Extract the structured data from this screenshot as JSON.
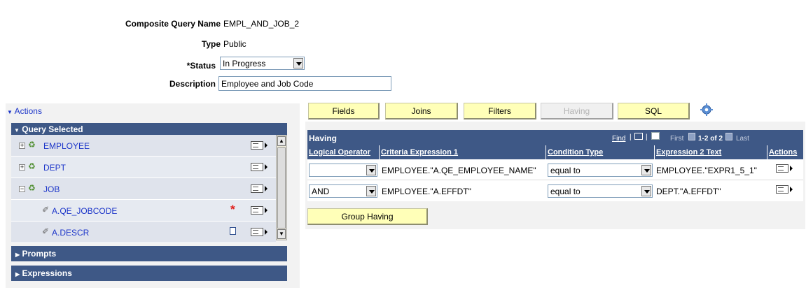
{
  "header": {
    "name_label": "Composite Query Name",
    "name_value": "EMPL_AND_JOB_2",
    "type_label": "Type",
    "type_value": "Public",
    "status_label": "*Status",
    "status_value": "In Progress",
    "description_label": "Description",
    "description_value": "Employee and Job Code"
  },
  "left": {
    "actions_label": "Actions",
    "query_selected_label": "Query Selected",
    "tree": [
      {
        "label": "EMPLOYEE",
        "expander": "+"
      },
      {
        "label": "DEPT",
        "expander": "+"
      },
      {
        "label": "JOB",
        "expander": "−"
      },
      {
        "label": "A.QE_JOBCODE",
        "required_marker": "*"
      },
      {
        "label": "A.DESCR"
      }
    ],
    "prompts_label": "Prompts",
    "expressions_label": "Expressions"
  },
  "tabs": {
    "fields": "Fields",
    "joins": "Joins",
    "filters": "Filters",
    "having": "Having",
    "sql": "SQL"
  },
  "grid": {
    "title": "Having",
    "find_label": "Find",
    "first_label": "First",
    "range_label": "1-2 of 2",
    "last_label": "Last",
    "columns": [
      "Logical Operator",
      "Criteria Expression 1",
      "Condition Type",
      "Expression 2 Text",
      "Actions"
    ],
    "rows": [
      {
        "logical": "",
        "criteria": "EMPLOYEE.\"A.QE_EMPLOYEE_NAME\"",
        "condition": "equal to",
        "expr2": "EMPLOYEE.\"EXPR1_5_1\""
      },
      {
        "logical": "AND",
        "criteria": "EMPLOYEE.\"A.EFFDT\"",
        "condition": "equal to",
        "expr2": "DEPT.\"A.EFFDT\""
      }
    ],
    "group_having_label": "Group Having"
  },
  "colors": {
    "header_blue": "#3e5886",
    "tab_yellow": "#ffffb8",
    "link_blue": "#1d36c9",
    "required_red": "#e0201c"
  }
}
